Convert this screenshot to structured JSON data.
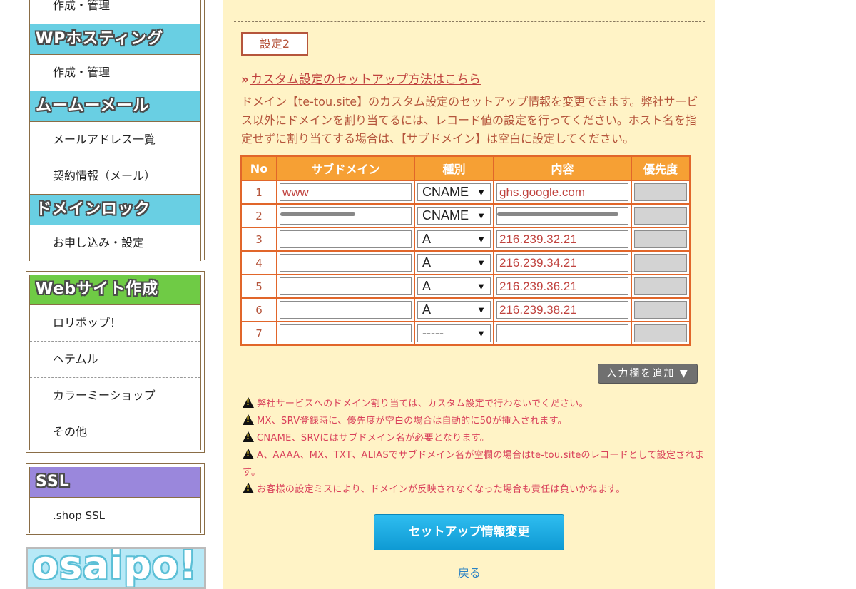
{
  "sidebar": {
    "box1_first_item": "作成・管理",
    "wp_hosting": {
      "title": "WPホスティング",
      "items": [
        "作成・管理"
      ]
    },
    "muumuu_mail": {
      "title": "ムームーメール",
      "items": [
        "メールアドレス一覧",
        "契約情報（メール）"
      ]
    },
    "domain_lock": {
      "title": "ドメインロック",
      "items": [
        "お申し込み・設定"
      ]
    },
    "website": {
      "title": "Webサイト作成",
      "items": [
        "ロリポップ！",
        "ヘテムル",
        "カラーミーショップ",
        "その他"
      ]
    },
    "ssl": {
      "title": "SSL",
      "items": [
        ".shop SSL"
      ]
    },
    "banner_text": "osaipo!"
  },
  "main": {
    "setting_label": "設定2",
    "setup_link": "カスタム設定のセットアップ方法はこちら",
    "description": "ドメイン【te-tou.site】のカスタム設定のセットアップ情報を変更できます。弊社サービス以外にドメインを割り当てるには、レコード値の設定を行ってください。ホスト名を指定せずに割り当てする場合は、【サブドメイン】は空白に設定してください。",
    "table": {
      "headers": [
        "No",
        "サブドメイン",
        "種別",
        "内容",
        "優先度"
      ],
      "rows": [
        {
          "no": "1",
          "subdomain": "www",
          "type": "CNAME",
          "content": "ghs.google.com"
        },
        {
          "no": "2",
          "subdomain": "",
          "type": "CNAME",
          "content": ""
        },
        {
          "no": "3",
          "subdomain": "",
          "type": "A",
          "content": "216.239.32.21"
        },
        {
          "no": "4",
          "subdomain": "",
          "type": "A",
          "content": "216.239.34.21"
        },
        {
          "no": "5",
          "subdomain": "",
          "type": "A",
          "content": "216.239.36.21"
        },
        {
          "no": "6",
          "subdomain": "",
          "type": "A",
          "content": "216.239.38.21"
        },
        {
          "no": "7",
          "subdomain": "",
          "type": "-----",
          "content": ""
        }
      ]
    },
    "add_rows_button": "入力欄を追加",
    "notes": [
      "弊社サービスへのドメイン割り当ては、カスタム設定で行わないでください。",
      "MX、SRV登録時に、優先度が空白の場合は自動的に50が挿入されます。",
      "CNAME、SRVにはサブドメイン名が必要となります。",
      "A、AAAA、MX、TXT、ALIASでサブドメイン名が空欄の場合はte-tou.siteのレコードとして設定されます。",
      "お客様の設定ミスにより、ドメインが反映されなくなった場合も責任は負いかねます。"
    ],
    "submit_button": "セットアップ情報変更",
    "back_link": "戻る"
  },
  "colors": {
    "page_bg": "#ffffff",
    "main_bg": "#fff3c6",
    "table_header": "#f6a034",
    "table_border": "#e1662a",
    "text_brown": "#b5553c",
    "note_pink": "#d9405a",
    "submit_blue": "#1aa9e0",
    "link_blue": "#2a82c4"
  }
}
